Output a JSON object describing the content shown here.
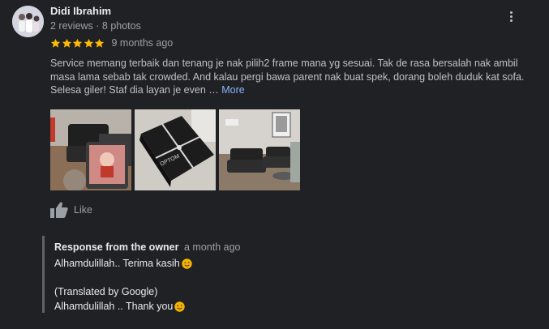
{
  "author": {
    "name": "Didi Ibrahim",
    "meta": "2 reviews · 8 photos"
  },
  "rating": {
    "stars": 5,
    "max_stars": 5,
    "time": "9 months ago"
  },
  "review": {
    "text": "Service memang terbaik dan tenang je nak pilih2 frame mana yg sesuai. Tak de rasa bersalah nak ambil masa lama sebab tak crowded. And kalau pergi bawa parent nak buat spek, dorang boleh duduk kat sofa. Selesa giler! Staf dia layan je even …",
    "more_label": "More"
  },
  "photos": [
    {
      "icon": "showroom-sofa-photo"
    },
    {
      "icon": "optom-gift-box-photo"
    },
    {
      "icon": "waiting-area-photo"
    }
  ],
  "actions": {
    "like_label": "Like"
  },
  "owner_response": {
    "title": "Response from the owner",
    "time": "a month ago",
    "line1": "Alhamdulillah.. Terima kasih",
    "line2": "(Translated by Google)",
    "line3": "Alhamdulillah .. Thank you"
  },
  "colors": {
    "background": "#202124",
    "star": "#fbbc04",
    "link": "#8ab4f8",
    "muted": "#9aa0a6"
  }
}
